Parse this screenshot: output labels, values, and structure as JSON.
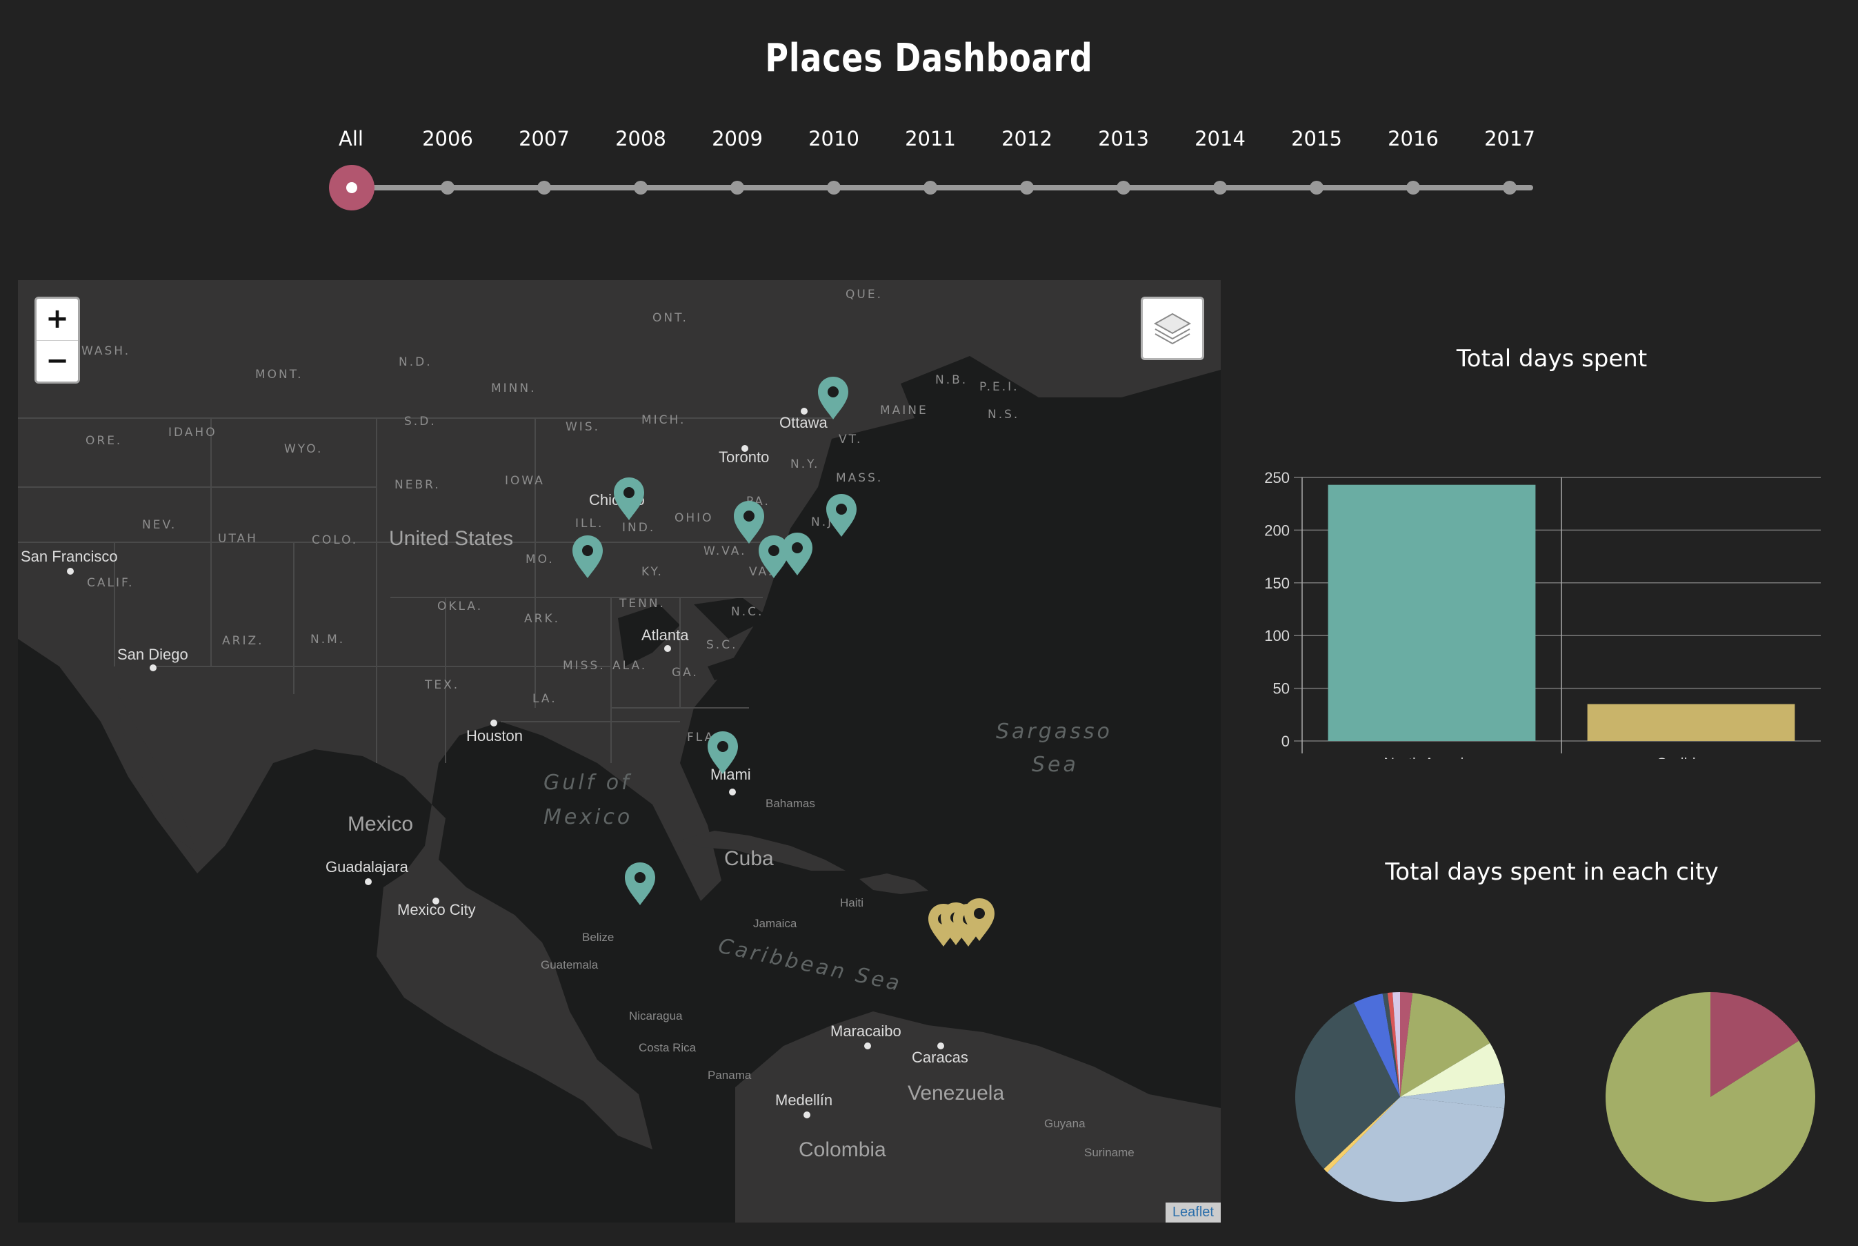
{
  "page": {
    "title": "Places Dashboard"
  },
  "timeline": {
    "labels": [
      "All",
      "2006",
      "2007",
      "2008",
      "2009",
      "2010",
      "2011",
      "2012",
      "2013",
      "2014",
      "2015",
      "2016",
      "2017"
    ],
    "selected": "All"
  },
  "map": {
    "zoom_in_label": "+",
    "zoom_out_label": "−",
    "attribution": "Leaflet",
    "labels": {
      "cities": [
        "San Francisco",
        "San Diego",
        "Chicago",
        "Toronto",
        "Ottawa",
        "Atlanta",
        "Houston",
        "Miami",
        "Guadalajara",
        "Mexico City",
        "Maracaibo",
        "Caracas",
        "Medellín"
      ],
      "countries": [
        "United States",
        "Mexico",
        "Cuba",
        "Venezuela",
        "Colombia"
      ],
      "states": [
        "WASH.",
        "MONT.",
        "N.D.",
        "MINN.",
        "ONT.",
        "QUE.",
        "ORE.",
        "IDAHO",
        "WYO.",
        "S.D.",
        "WIS.",
        "MICH.",
        "N.B.",
        "P.E.I.",
        "N.S.",
        "MAINE",
        "VT.",
        "N.Y.",
        "MASS.",
        "NEBR.",
        "IOWA",
        "NEV.",
        "UTAH",
        "COLO.",
        "ILL.",
        "IND.",
        "OHIO",
        "PA.",
        "N.J.",
        "W.VA.",
        "VA.",
        "MO.",
        "KY.",
        "CALIF.",
        "OKLA.",
        "ARK.",
        "TENN.",
        "N.C.",
        "ARIZ.",
        "N.M.",
        "MISS.",
        "ALA.",
        "S.C.",
        "GA.",
        "TEX.",
        "LA.",
        "FLA."
      ],
      "seas": [
        "Gulf of",
        "Mexico",
        "Sargasso",
        "Sea",
        "Caribbean Sea"
      ],
      "small": [
        "Bahamas",
        "Jamaica",
        "Haiti",
        "Belize",
        "Guatemala",
        "Nicaragua",
        "Costa Rica",
        "Panama",
        "Guyana",
        "Suriname"
      ]
    },
    "markers": {
      "north_america_color": "#6aada3",
      "caribbean_color": "#c9b46a"
    }
  },
  "colors": {
    "accent": "#b2566f",
    "north_america": "#6aada3",
    "caribbean": "#c9b46a"
  },
  "bar_title": "Total days spent",
  "pie_title": "Total days spent in each city",
  "chart_data": [
    {
      "type": "bar",
      "categories": [
        "North America",
        "Caribbean"
      ],
      "values": [
        243,
        35
      ],
      "colors": [
        "#6aada3",
        "#c9b46a"
      ],
      "ylim": [
        0,
        250
      ],
      "yticks": [
        0,
        50,
        100,
        150,
        200,
        250
      ],
      "grid": true
    },
    {
      "type": "pie",
      "values": [
        5,
        38,
        17,
        10,
        93,
        2,
        78,
        12,
        2,
        2,
        3
      ],
      "colors": [
        "#b2566f",
        "#a3ae67",
        "#ecf7d2",
        "#aec3d8",
        "#b1c4d9",
        "#f6cf6a",
        "#3e5259",
        "#4c6edb",
        "#3e5259",
        "#d95757",
        "#d6c8e8"
      ]
    },
    {
      "type": "pie",
      "values": [
        16,
        84
      ],
      "colors": [
        "#a34d65",
        "#a3ae67"
      ]
    }
  ]
}
